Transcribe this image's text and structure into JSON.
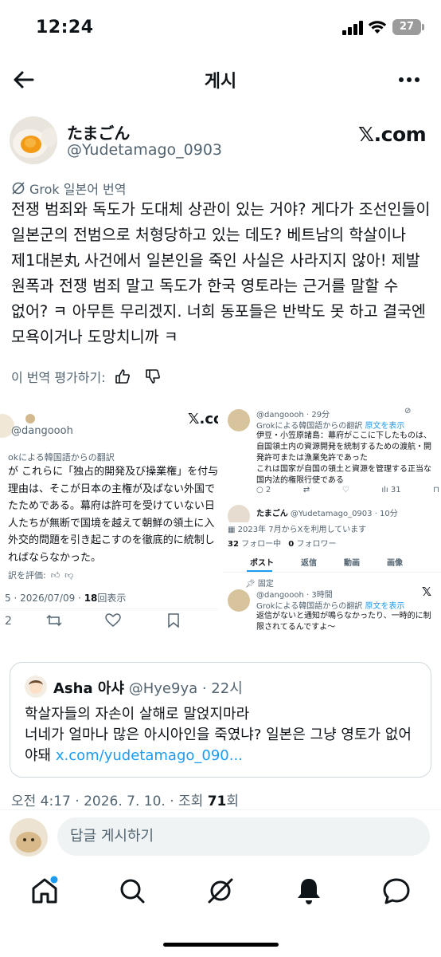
{
  "status": {
    "time": "12:24",
    "battery": "27"
  },
  "nav": {
    "title": "게시"
  },
  "author": {
    "name": "たまごん",
    "handle": "@Yudetamago_0903",
    "brand": "𝕏.com"
  },
  "translation": {
    "label": "Grok 일본어 번역",
    "text": "전쟁 범죄와 독도가 도대체 상관이 있는 거야? 게다가 조선인들이 일본군의 전범으로 처형당하고 있는 데도? 베트남의 학살이나 제1대본丸 사건에서 일본인을 죽인 사실은 사라지지 않아! 제발 원폭과 전쟁 범죄 말고 독도가 한국 영토라는 근거를 말할 수 없어? ㅋ 아무튼 무리겠지. 너희 동포들은 반박도 못 하고 결국엔 모욕이거나 도망치니까 ㅋ",
    "rate_label": "이 번역 평가하기:"
  },
  "media_left": {
    "handle": "@dangoooh",
    "brand": "𝕏.co",
    "grok_note": "okによる韓国語からの翻訳",
    "lines": [
      "が これらに「独占的開発及び操業権」を付与",
      "理由は、そこが日本の主権が及ばない外国で",
      "たためである。幕府は許可を受けていない日",
      "人たちが無断で国境を越えて朝鮮の領土に入",
      "外交的問題を引き起こすのを徹底的に統制し",
      "ればならなかった。"
    ],
    "rate": "訳を評価:",
    "date": "5 · 2026/07/09 · ",
    "views": "18",
    "views_label": "回表示",
    "reply_count": "2"
  },
  "media_right": {
    "post1_handle": "@dangoooh · 29分",
    "post1_grok": "Grokによる韓国語からの翻訳",
    "post1_original": "原文を表示",
    "post1_lines": [
      "伊豆・小笠原諸島：幕府がここに下したものは、",
      "自国領土内の資源開発を統制するための渡航・開",
      "発許可または漁業免許であった",
      "これは国家が自国の領土と資源を管理する正当な",
      "国内法的権限行使である"
    ],
    "post1_replies": "2",
    "post1_views": "31",
    "post2_name": "たまごん",
    "post2_handle": "@Yudetamago_0903 · 10分",
    "joined": "2023年 7月からXを利用しています",
    "following": "32",
    "following_label": "フォロー中",
    "followers": "0",
    "followers_label": "フォロワー",
    "tabs": [
      "ポスト",
      "返信",
      "動画",
      "画像"
    ],
    "pinned": "固定",
    "post3_handle": "@dangoooh · 3時間",
    "post3_grok": "Grokによる韓国語からの翻訳",
    "post3_original": "原文を表示",
    "post3_lines": [
      "返信がないと通知が鳴らなかったり、一時的に制",
      "限されてるんですよ〜"
    ]
  },
  "quote": {
    "name": "Asha 아샤",
    "handle": "@Hye9ya · 22시",
    "line1": "학살자들의 자손이 살해로 말얹지마라",
    "line2": "너네가 얼마나 많은 아시아인을 죽였냐? 일본은 그냥 영토가 없어야돼 ",
    "link": "x.com/yudetamago_090..."
  },
  "meta": {
    "time": "오전 4:17 · 2026. 7. 10. · 조회 ",
    "views": "71",
    "views_suffix": "회"
  },
  "reply": {
    "placeholder": "답글 게시하기"
  },
  "tabbar": {
    "items": [
      "home-icon",
      "search-icon",
      "grok-icon",
      "notifications-icon",
      "messages-icon"
    ]
  },
  "colors": {
    "accent": "#1d9bf0",
    "secondary": "#536471",
    "text": "#0f1419"
  }
}
